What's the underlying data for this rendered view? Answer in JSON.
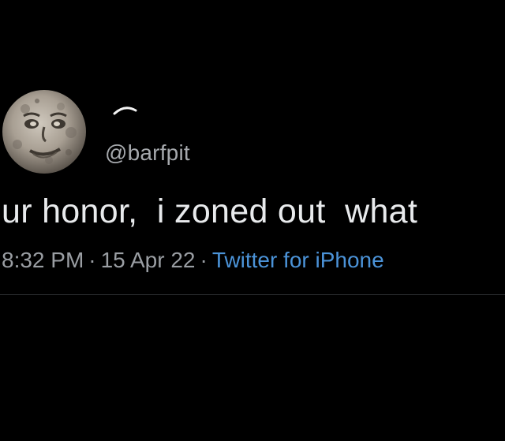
{
  "tweet": {
    "handle": "@barfpit",
    "text": "ur honor,  i zoned out  what",
    "time": "8:32 PM",
    "separator": "·",
    "date": "15 Apr 22",
    "source": "Twitter for iPhone"
  },
  "colors": {
    "background": "#000000",
    "text": "#e8eaec",
    "secondary": "#9a9ea3",
    "link": "#4b93d8"
  },
  "icons": {
    "avatar": "moon-face-avatar"
  }
}
